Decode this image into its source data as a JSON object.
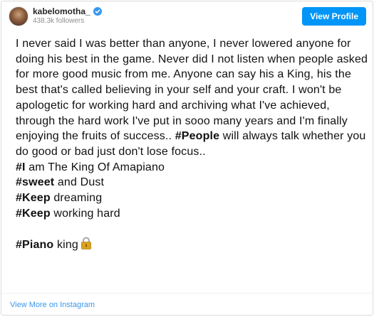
{
  "header": {
    "username": "kabelomotha_",
    "followers": "438.3k followers",
    "view_profile_label": "View Profile"
  },
  "post": {
    "paragraph": "I never said I was better than anyone, I never lowered anyone for doing his best in the game. Never did I not listen when people asked for more good music from me. Anyone can say his a King, his the best that's called believing in your self and your craft. I won't be apologetic for working hard and archiving what I've achieved, through the hard work I've put in sooo many years and I'm finally enjoying the fruits of success.. ",
    "people_tag": "#People",
    "people_rest": " will always talk whether you do good or bad just don't lose focus..",
    "lines": [
      {
        "tag": "#I",
        "rest": " am The King Of Amapiano"
      },
      {
        "tag": "#sweet",
        "rest": " and Dust"
      },
      {
        "tag": "#Keep",
        "rest": " dreaming"
      },
      {
        "tag": "#Keep",
        "rest": " working hard"
      }
    ],
    "final_tag": "#Piano",
    "final_rest": " king"
  },
  "icons": {
    "verified": "verified-badge-icon",
    "lock": "lock-icon",
    "accent_color": "#0095f6"
  },
  "footer": {
    "view_more_label": "View More on Instagram"
  }
}
